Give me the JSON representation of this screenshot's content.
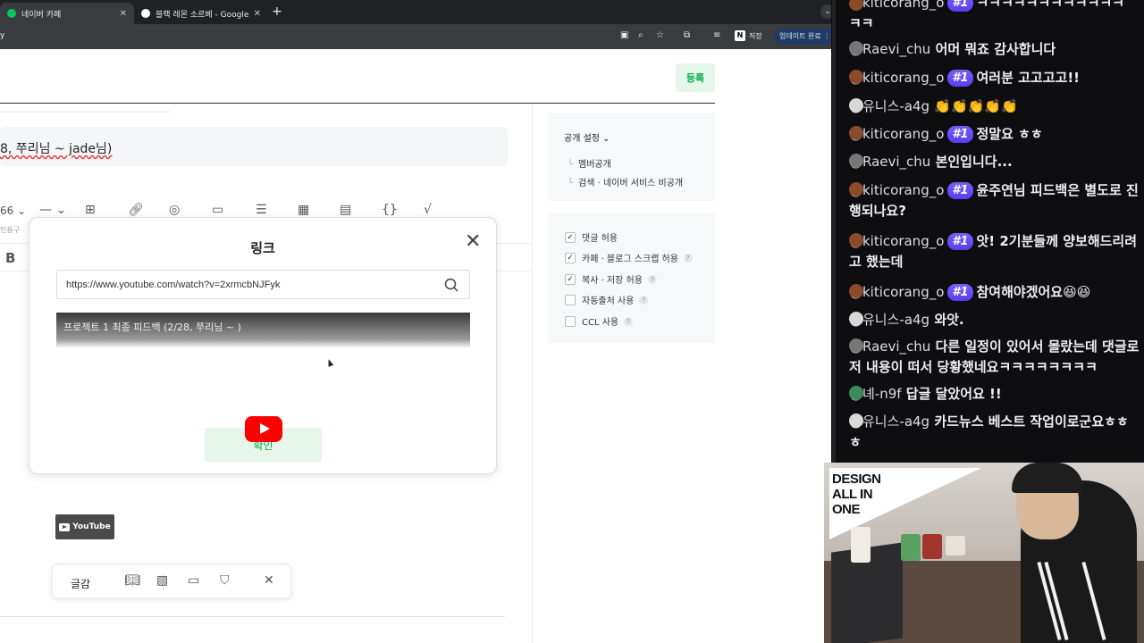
{
  "browser": {
    "tabs": [
      {
        "title": "네이버 카페",
        "favicon_color": "#03c75a",
        "active": true
      },
      {
        "title": "블랙 레몬 소르베 - Google 검색",
        "favicon_color": "#ffffff",
        "active": false
      }
    ],
    "new_tab_label": "+",
    "url_fragment": "y",
    "profile_label": "직장",
    "update_label": "업데이트 완료"
  },
  "editor": {
    "register_label": "등록",
    "title_text": "8, 쭈리님 ~ jade님)",
    "quote_label": "인용구",
    "font_size_value": "66",
    "bold_label": "B"
  },
  "link_dialog": {
    "title": "링크",
    "url_value": "https://www.youtube.com/watch?v=2xrmcbNJFyk",
    "preview_title": "프로젝트 1 최종 피드백 (2/28, 쭈리님 ~ )",
    "confirm_label": "확인"
  },
  "youtube_chip": {
    "label": "YouTube"
  },
  "float_bar": {
    "text_label": "글감"
  },
  "side_panel": {
    "visibility_title": "공개 설정",
    "visibility_options": [
      "멤버공개",
      "검색 · 네이버 서비스 비공개"
    ],
    "checkboxes": [
      {
        "label": "댓글 허용",
        "checked": true,
        "help": false
      },
      {
        "label": "카페 · 블로그 스크랩 허용",
        "checked": true,
        "help": true
      },
      {
        "label": "복사 · 저장 허용",
        "checked": true,
        "help": true
      },
      {
        "label": "자동출처 사용",
        "checked": false,
        "help": true
      },
      {
        "label": "CCL 사용",
        "checked": false,
        "help": true
      }
    ]
  },
  "chat": {
    "messages": [
      {
        "user": "@kiticorang_o",
        "badge": "#1",
        "text": "ㅋㅋㅋㅋㅋㅋㅋㅋㅋㅋㅋㅋ ㅋㅋ",
        "avatar_color": "#8a4b2c"
      },
      {
        "user": "@Raevi_chu",
        "badge": "",
        "text": "어머 뭐죠 감사합니다",
        "avatar_color": "#777777"
      },
      {
        "user": "@kiticorang_o",
        "badge": "#1",
        "text": "여러분 고고고고!!",
        "avatar_color": "#8a4b2c"
      },
      {
        "user": "@유니스-a4g",
        "badge": "",
        "text": "👏👏👏👏👏",
        "avatar_color": "#d8d8d8"
      },
      {
        "user": "@kiticorang_o",
        "badge": "#1",
        "text": "정말요 ㅎㅎ",
        "avatar_color": "#8a4b2c"
      },
      {
        "user": "@Raevi_chu",
        "badge": "",
        "text": "본인입니다...",
        "avatar_color": "#777777"
      },
      {
        "user": "@kiticorang_o",
        "badge": "#1",
        "text": "윤주연님 피드백은 별도로 진행되나요?",
        "avatar_color": "#8a4b2c"
      },
      {
        "user": "@kiticorang_o",
        "badge": "#1",
        "text": "앗! 2기분들께 양보해드리려고 했는데",
        "avatar_color": "#8a4b2c"
      },
      {
        "user": "@kiticorang_o",
        "badge": "#1",
        "text": "참여해야겠어요😆😆",
        "avatar_color": "#8a4b2c"
      },
      {
        "user": "@유니스-a4g",
        "badge": "",
        "text": "와앗.",
        "avatar_color": "#d8d8d8"
      },
      {
        "user": "@Raevi_chu",
        "badge": "",
        "text": "다른 일정이 있어서 몰랐는데 댓글로 저 내용이 떠서 당황했네요ㅋㅋㅋㅋㅋㅋㅋㅋ",
        "avatar_color": "#777777"
      },
      {
        "user": "@녜-n9f",
        "badge": "",
        "text": "답글 달았어요 !!",
        "avatar_color": "#3c8b5a"
      },
      {
        "user": "@유니스-a4g",
        "badge": "",
        "text": "카드뉴스 베스트 작업이로군요ㅎㅎ ㅎ",
        "avatar_color": "#d8d8d8"
      }
    ]
  },
  "webcam": {
    "poster_text": "DESIGN ALL IN ONE"
  }
}
